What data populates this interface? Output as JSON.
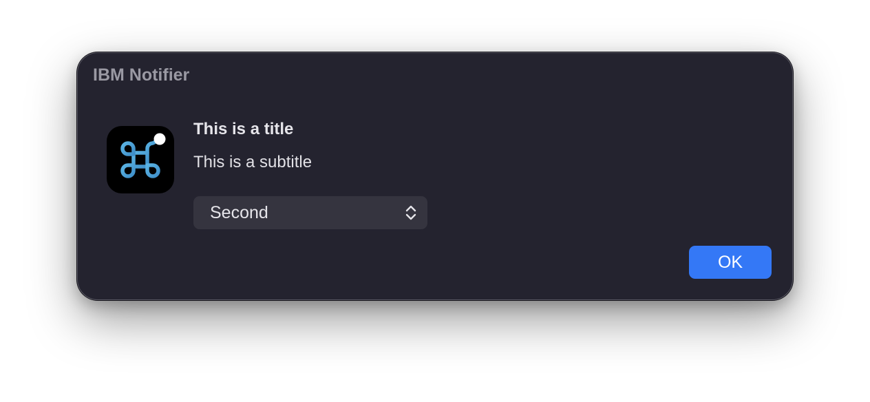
{
  "window": {
    "title": "IBM Notifier"
  },
  "app_icon": {
    "icon": "command-key-icon",
    "badge": "notification-dot",
    "colors": {
      "background": "#000000",
      "glyph": "#4ba3d6",
      "badge": "#ffffff"
    }
  },
  "message": {
    "title": "This is a title",
    "subtitle": "This is a subtitle"
  },
  "popup": {
    "selected": "Second",
    "icon": "up-down-chevrons-icon"
  },
  "buttons": {
    "ok": "OK"
  },
  "colors": {
    "window_background": "#24232f",
    "accent": "#3478f6",
    "popup_background": "#35343f"
  }
}
